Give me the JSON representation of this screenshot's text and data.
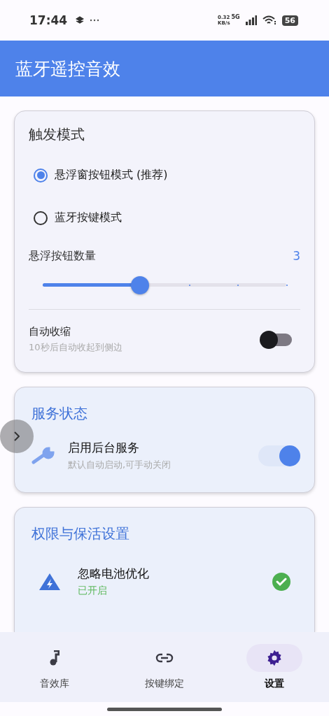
{
  "status_bar": {
    "time": "17:44",
    "speed_value": "0.32",
    "speed_unit": "KB/s",
    "network": "5G",
    "battery": "56"
  },
  "app_bar": {
    "title": "蓝牙遥控音效"
  },
  "trigger_card": {
    "title": "触发模式",
    "options": [
      {
        "label": "悬浮窗按钮模式 (推荐)",
        "selected": true
      },
      {
        "label": "蓝牙按键模式",
        "selected": false
      }
    ],
    "slider": {
      "label": "悬浮按钮数量",
      "value": "3",
      "level": 0.4
    },
    "auto_collapse": {
      "label": "自动收缩",
      "description": "10秒后自动收起到侧边",
      "on": false
    }
  },
  "service_card": {
    "title": "服务状态",
    "label": "启用后台服务",
    "description": "默认自动启动,可手动关闭",
    "on": true
  },
  "permissions_card": {
    "title": "权限与保活设置",
    "items": [
      {
        "label": "忽略电池优化",
        "status": "已开启",
        "granted": true
      }
    ]
  },
  "bottom_nav": [
    {
      "label": "音效库",
      "kind": "music",
      "selected": false
    },
    {
      "label": "按键绑定",
      "kind": "link",
      "selected": false
    },
    {
      "label": "设置",
      "kind": "gear",
      "selected": true
    }
  ]
}
